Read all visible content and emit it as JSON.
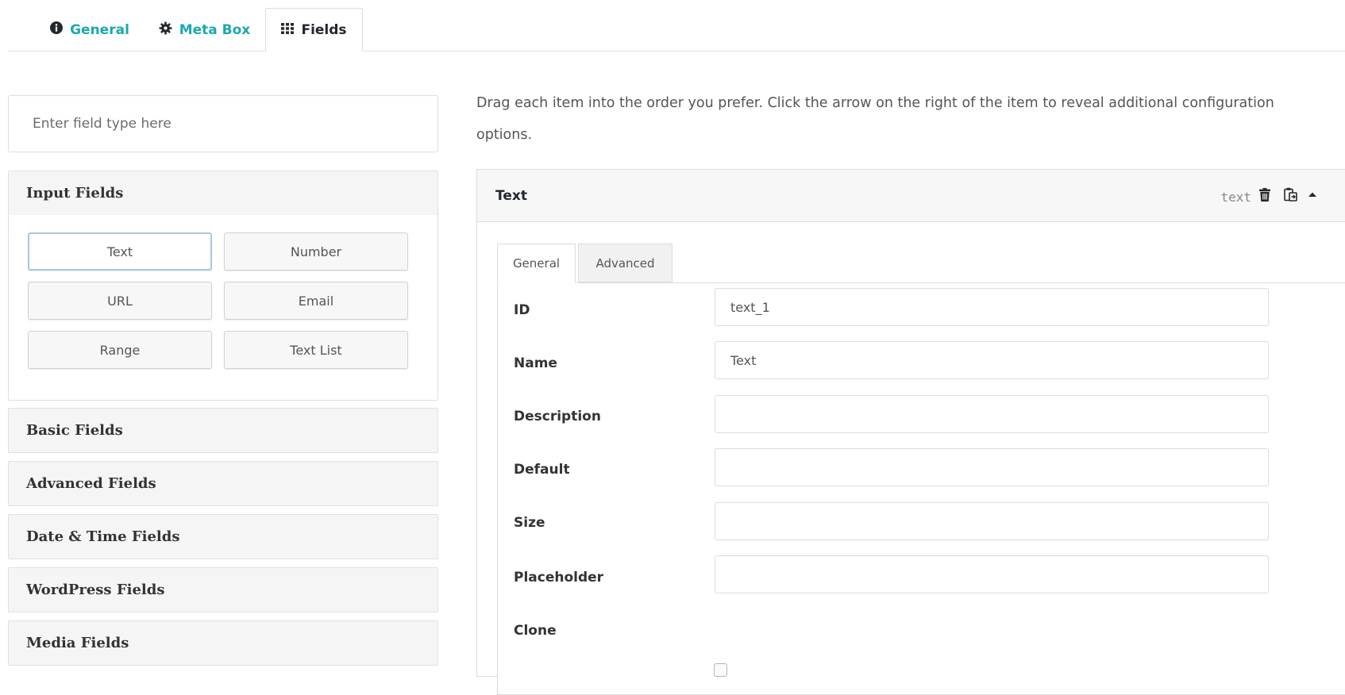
{
  "top_tabs": [
    {
      "label": "General",
      "icon": "info-circle-icon"
    },
    {
      "label": "Meta Box",
      "icon": "gear-icon"
    },
    {
      "label": "Fields",
      "icon": "grid-icon",
      "active": true
    }
  ],
  "search": {
    "placeholder": "Enter field type here"
  },
  "groups": {
    "input": {
      "title": "Input Fields",
      "buttons": [
        "Text",
        "Number",
        "URL",
        "Email",
        "Range",
        "Text List"
      ]
    },
    "basic": {
      "title": "Basic Fields"
    },
    "advanced": {
      "title": "Advanced Fields"
    },
    "datetime": {
      "title": "Date & Time Fields"
    },
    "wordpress": {
      "title": "WordPress Fields"
    },
    "media": {
      "title": "Media Fields"
    }
  },
  "instructions": "Drag each item into the order you prefer. Click the arrow on the right of the item to reveal additional configuration options.",
  "field_card": {
    "title": "Text",
    "type": "text",
    "actions": [
      "trash-icon",
      "clone-icon",
      "collapse-arrow-icon"
    ],
    "tabs": [
      "General",
      "Advanced"
    ],
    "rows": [
      {
        "label": "ID",
        "value": "text_1"
      },
      {
        "label": "Name",
        "value": "Text"
      },
      {
        "label": "Description",
        "value": ""
      },
      {
        "label": "Default",
        "value": ""
      },
      {
        "label": "Size",
        "value": ""
      },
      {
        "label": "Placeholder",
        "value": ""
      }
    ],
    "clone": {
      "label": "Clone",
      "checked": false
    }
  },
  "colors": {
    "accent": "#1aa9ae",
    "dark": "#23282d"
  }
}
